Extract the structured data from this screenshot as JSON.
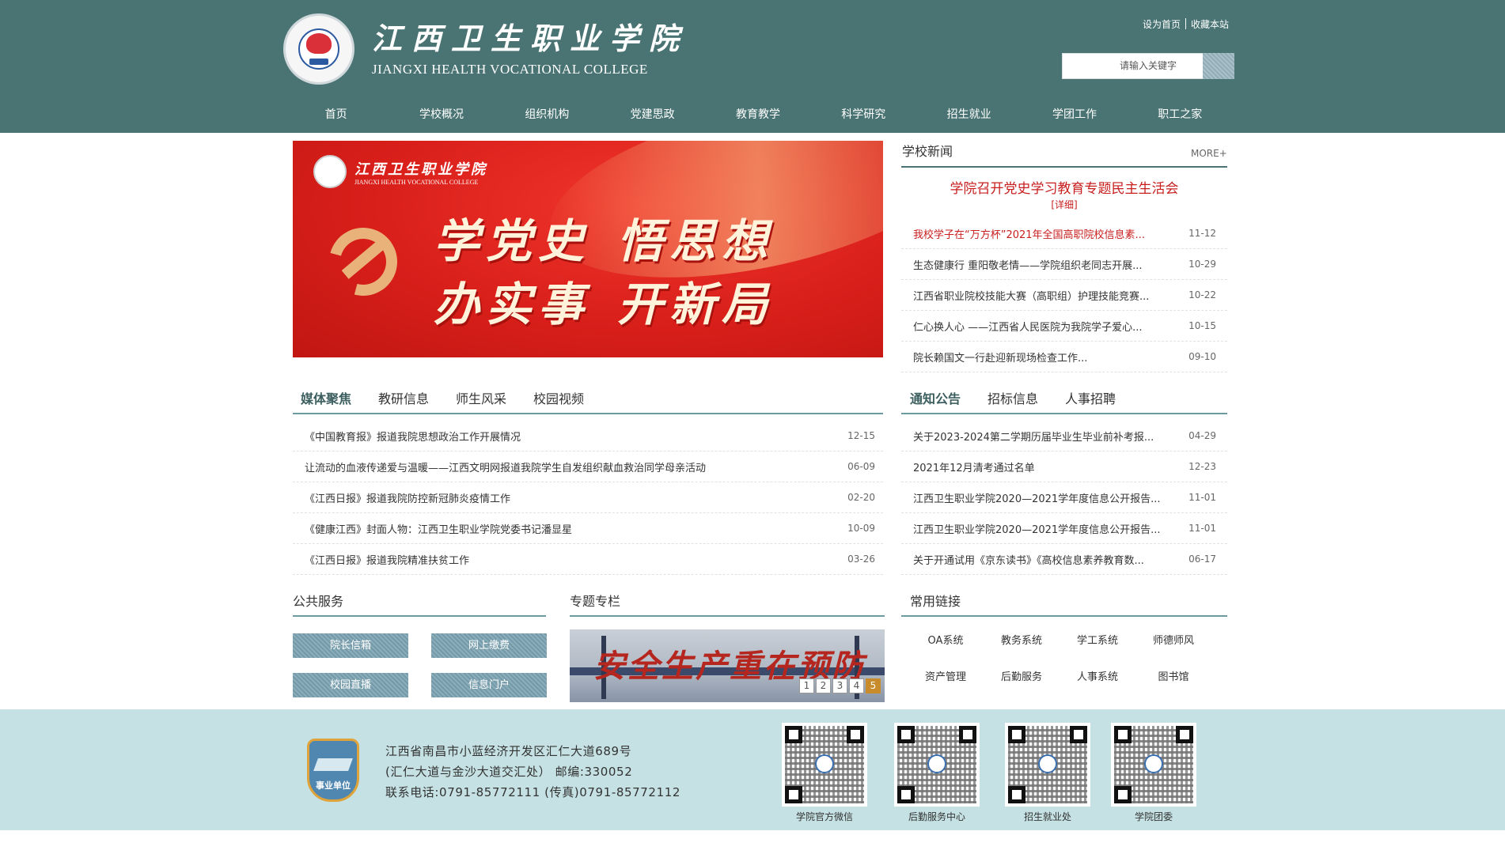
{
  "header": {
    "college_cn": "江西卫生职业学院",
    "college_en": "JIANGXI HEALTH VOCATIONAL COLLEGE",
    "top_links": [
      "设为首页",
      "收藏本站"
    ],
    "search_placeholder": "请输入关键字"
  },
  "nav": [
    "首页",
    "学校概况",
    "组织机构",
    "党建思政",
    "教育教学",
    "科学研究",
    "招生就业",
    "学团工作",
    "职工之家"
  ],
  "banner": {
    "college_cn": "江西卫生职业学院",
    "college_en": "JIANGXI HEALTH VOCATIONAL COLLEGE",
    "line1a": "学党史",
    "line1b": "悟思想",
    "line2a": "办实事",
    "line2b": "开新局"
  },
  "school_news": {
    "title": "学校新闻",
    "more": "MORE+",
    "headline": "学院召开党史学习教育专题民主生活会",
    "detail": "[详细]",
    "items": [
      {
        "title": "我校学子在“万方杯”2021年全国高职院校信息素...",
        "date": "11-12"
      },
      {
        "title": "生态健康行 重阳敬老情——学院组织老同志开展...",
        "date": "10-29"
      },
      {
        "title": "江西省职业院校技能大赛（高职组）护理技能竞赛...",
        "date": "10-22"
      },
      {
        "title": "仁心换人心 ——江西省人民医院为我院学子爱心...",
        "date": "10-15"
      },
      {
        "title": "院长赖国文一行赴迎新现场检查工作...",
        "date": "09-10"
      }
    ]
  },
  "media_tabs": [
    "媒体聚焦",
    "教研信息",
    "师生风采",
    "校园视频"
  ],
  "media_items": [
    {
      "title": "《中国教育报》报道我院思想政治工作开展情况",
      "date": "12-15"
    },
    {
      "title": "让流动的血液传递爱与温暖——江西文明网报道我院学生自发组织献血救治同学母亲活动",
      "date": "06-09"
    },
    {
      "title": "《江西日报》报道我院防控新冠肺炎疫情工作",
      "date": "02-20"
    },
    {
      "title": "《健康江西》封面人物：江西卫生职业学院党委书记潘显星",
      "date": "10-09"
    },
    {
      "title": "《江西日报》报道我院精准扶贫工作",
      "date": "03-26"
    }
  ],
  "notice_tabs": [
    "通知公告",
    "招标信息",
    "人事招聘"
  ],
  "notice_items": [
    {
      "title": "关于2023-2024第二学期历届毕业生毕业前补考报...",
      "date": "04-29"
    },
    {
      "title": "2021年12月清考通过名单",
      "date": "12-23"
    },
    {
      "title": "江西卫生职业学院2020—2021学年度信息公开报告...",
      "date": "11-01"
    },
    {
      "title": "江西卫生职业学院2020—2021学年度信息公开报告...",
      "date": "11-01"
    },
    {
      "title": "关于开通试用《京东读书》《高校信息素养教育数...",
      "date": "06-17"
    }
  ],
  "public_service": {
    "title": "公共服务",
    "buttons": [
      "院长信箱",
      "网上缴费",
      "校园直播",
      "信息门户"
    ]
  },
  "special": {
    "title": "专题专栏",
    "slide_text": "安全生产重在预防",
    "pages": [
      "1",
      "2",
      "3",
      "4",
      "5"
    ]
  },
  "links": {
    "title": "常用链接",
    "items": [
      "OA系统",
      "教务系统",
      "学工系统",
      "师德师风",
      "资产管理",
      "后勤服务",
      "人事系统",
      "图书馆"
    ]
  },
  "footer": {
    "badge": "事业单位",
    "addr1": "江西省南昌市小蓝经济开发区汇仁大道689号",
    "addr2": "(汇仁大道与金沙大道交汇处）  邮编:330052",
    "addr3": "联系电话:0791-85772111  (传真)0791-85772112",
    "qr_captions": [
      "学院官方微信",
      "后勤服务中心",
      "招生就业处",
      "学院团委"
    ]
  }
}
